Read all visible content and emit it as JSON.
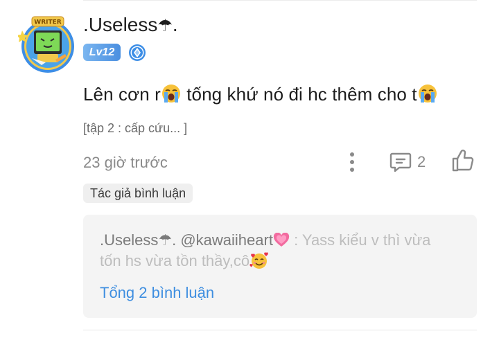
{
  "comment": {
    "username": ".Useless",
    "username_suffix": ".",
    "level": "Lv12",
    "text_part1": "Lên cơn r",
    "text_part2": " tống khứ nó đi hc thêm cho t",
    "chapter": "[tập 2 : cấp cứu... ]",
    "timestamp": "23 giờ trước",
    "reply_count": "2",
    "author_tag": "Tác giả bình luận"
  },
  "reply": {
    "author": ".Useless",
    "author_suffix": ".",
    "mention": "@kawaiiheart",
    "text_part1": " : Yass kiểu v thì vừa tốn hs vừa tồn thầy,cô",
    "total_label": "Tổng 2 bình luận"
  },
  "icons": {
    "avatar_badge": "writer-badge",
    "umbrella": "umbrella-icon",
    "crying_face": "loudly-crying-face-icon",
    "heart": "growing-heart-icon",
    "smiling_hearts": "smiling-face-with-hearts-icon",
    "rank": "diamond-rank-icon",
    "more": "more-vertical-icon",
    "reply": "comment-icon",
    "like": "thumbs-up-icon"
  },
  "colors": {
    "level_badge": "#4a8fe0",
    "link_blue": "#3e8ee0",
    "muted_gray": "#8a8a8a",
    "reply_box_bg": "#f4f4f4"
  }
}
